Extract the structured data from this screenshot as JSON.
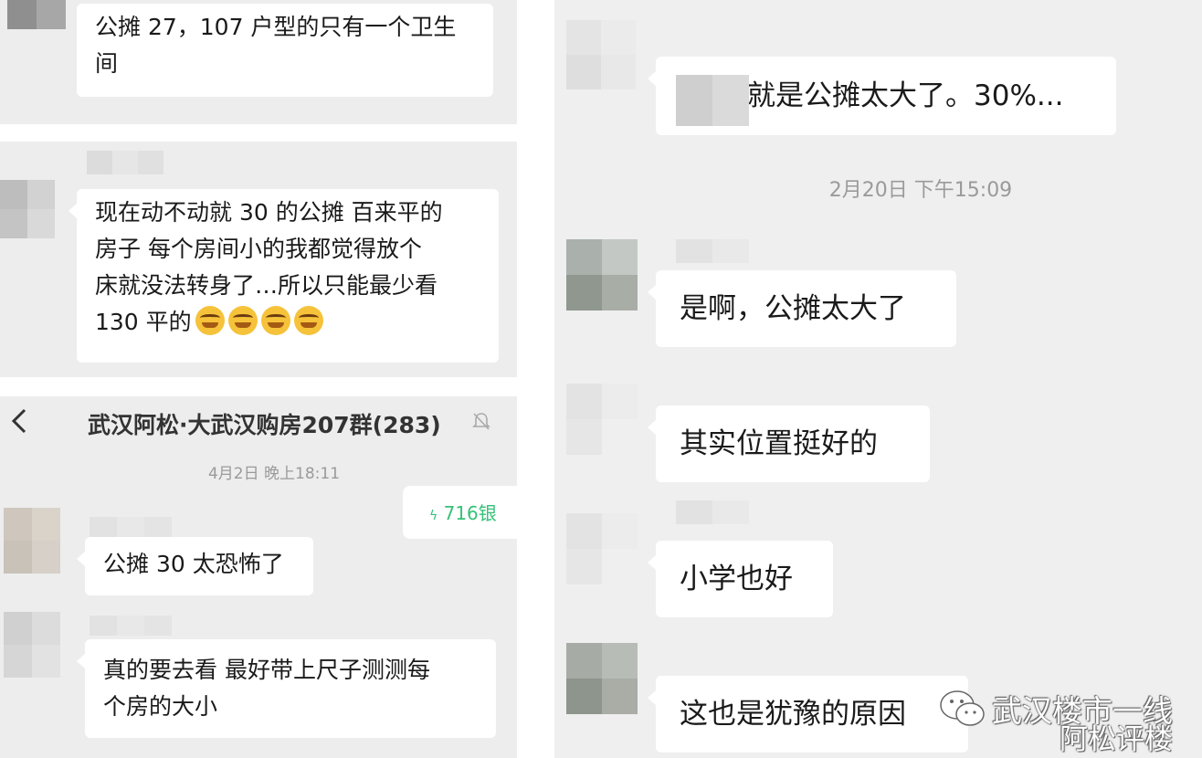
{
  "screenshot_1": {
    "message": {
      "lines": [
        "公摊 27，107 户型的只有一个卫生",
        "间"
      ]
    }
  },
  "screenshot_2": {
    "message": {
      "lines": [
        "现在动不动就 30 的公摊  百来平的",
        "房子  每个房间小的我都觉得放个",
        "床就没法转身了…所以只能最少看",
        "130 平的"
      ],
      "emoji_count": 4,
      "emoji_icon": "crying-emoji-icon"
    }
  },
  "screenshot_3": {
    "header": {
      "back_icon": "chevron-left-icon",
      "title": "武汉阿松·大武汉购房207群(283)",
      "mute_icon": "bell-muted-icon"
    },
    "timestamp": "4月2日  晚上18:11",
    "own_message": {
      "icon": "lightning-icon",
      "text": "716银"
    },
    "messages": [
      {
        "lines": [
          "公摊 30 太恐怖了"
        ]
      },
      {
        "lines": [
          "真的要去看  最好带上尺子测测每",
          "个房的大小"
        ]
      }
    ]
  },
  "screenshot_4": {
    "messages": [
      {
        "lines": [
          "就是公摊太大了。30%..."
        ]
      },
      {
        "lines": [
          "是啊，公摊太大了"
        ]
      },
      {
        "lines": [
          "其实位置挺好的"
        ]
      },
      {
        "lines": [
          "小学也好"
        ]
      },
      {
        "lines": [
          "这也是犹豫的原因"
        ]
      }
    ],
    "timestamp": "2月20日  下午15:09"
  },
  "watermark": {
    "logo_icon": "wechat-logo-icon",
    "line1": "武汉楼市一线",
    "line2": "阿松评楼"
  },
  "colors": {
    "chat_background": "#ededed",
    "bubble": "#ffffff",
    "own_message_text": "#34c278",
    "timestamp": "#9a9a9a"
  }
}
